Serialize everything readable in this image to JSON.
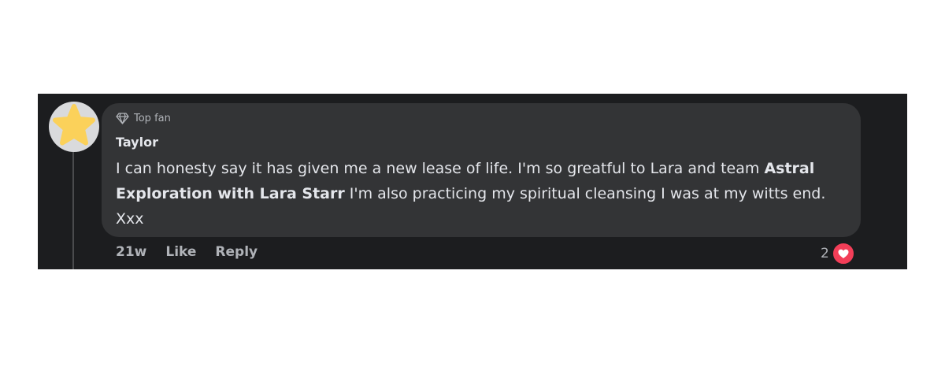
{
  "comment": {
    "badge": {
      "icon": "diamond-icon",
      "label": "Top fan"
    },
    "author": "Taylor",
    "text_before_mention": "I can honesty say it has given me a new lease of life. I'm so greatful to Lara and team ",
    "mention": "Astral Exploration with Lara Starr",
    "text_after_mention": " I'm also practicing my spiritual cleansing I was at my witts end. Xxx",
    "avatar_icon": "star-icon"
  },
  "actions": {
    "time": "21w",
    "like_label": "Like",
    "reply_label": "Reply"
  },
  "reactions": {
    "count": "2",
    "icon": "heart-icon",
    "color": "#f33e58"
  },
  "colors": {
    "background": "#1c1d1f",
    "bubble": "#333436",
    "text_primary": "#e4e6eb",
    "text_secondary": "#b0b3b8",
    "star": "#fbd15a"
  }
}
